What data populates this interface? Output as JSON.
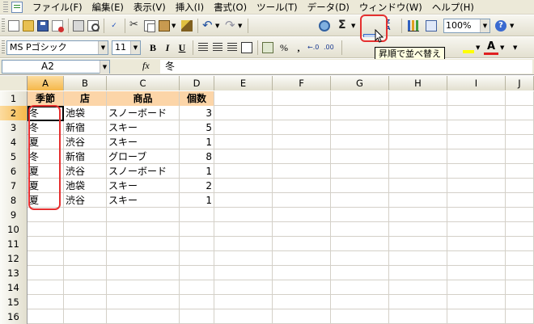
{
  "menu": [
    "ファイル(F)",
    "編集(E)",
    "表示(V)",
    "挿入(I)",
    "書式(O)",
    "ツール(T)",
    "データ(D)",
    "ウィンドウ(W)",
    "ヘルプ(H)"
  ],
  "toolbar": {
    "zoom": "100%",
    "tooltip": "昇順で並べ替え",
    "accent_highlight": "#e53030"
  },
  "format_bar": {
    "font_name": "MS Pゴシック",
    "font_size": "11",
    "bold": "B",
    "italic": "I",
    "underline": "U",
    "percent": "%",
    "comma": ","
  },
  "formula_bar": {
    "name_box": "A2",
    "fx": "fx",
    "value": "冬"
  },
  "columns": [
    "A",
    "B",
    "C",
    "D",
    "E",
    "F",
    "G",
    "H",
    "I",
    "J"
  ],
  "rows": [
    "1",
    "2",
    "3",
    "4",
    "5",
    "6",
    "7",
    "8",
    "9",
    "10",
    "11",
    "12",
    "13",
    "14",
    "15",
    "16"
  ],
  "table": {
    "headers": [
      "季節",
      "店",
      "商品",
      "個数"
    ],
    "data": [
      [
        "冬",
        "池袋",
        "スノーボード",
        "3"
      ],
      [
        "冬",
        "新宿",
        "スキー",
        "5"
      ],
      [
        "夏",
        "渋谷",
        "スキー",
        "1"
      ],
      [
        "冬",
        "新宿",
        "グローブ",
        "8"
      ],
      [
        "夏",
        "渋谷",
        "スノーボード",
        "1"
      ],
      [
        "夏",
        "池袋",
        "スキー",
        "2"
      ],
      [
        "夏",
        "渋谷",
        "スキー",
        "1"
      ]
    ]
  }
}
